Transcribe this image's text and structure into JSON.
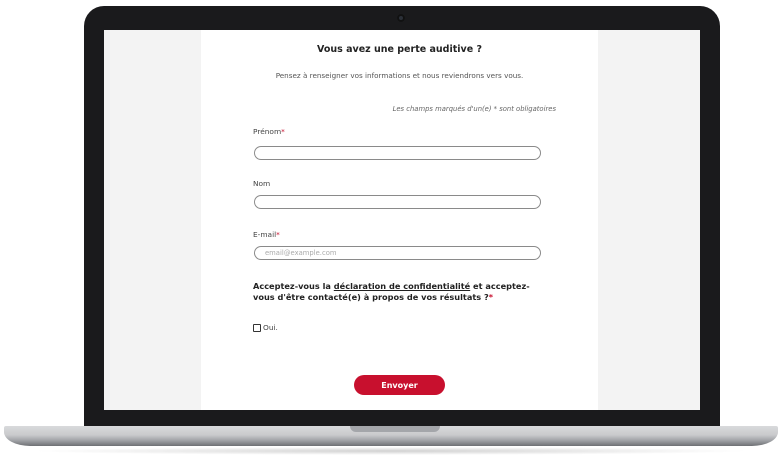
{
  "form": {
    "title": "Vous avez une perte auditive ?",
    "intro": "Pensez à renseigner vos informations et nous reviendrons vers vous.",
    "required_note": "Les champs marqués d'un(e) * sont obligatoires",
    "fields": [
      {
        "label": "Prénom",
        "required_mark": "*",
        "value": "",
        "placeholder": ""
      },
      {
        "label": "Nom",
        "required_mark": "",
        "value": "",
        "placeholder": ""
      },
      {
        "label": "E-mail",
        "required_mark": "*",
        "value": "",
        "placeholder": "email@example.com"
      }
    ],
    "consent": {
      "prefix": "Acceptez-vous la ",
      "link_text": "déclaration de confidentialité",
      "suffix": " et acceptez-vous d'être contacté(e) à propos de vos résultats ?",
      "required_mark": "*"
    },
    "checkbox": {
      "label": "Oui.",
      "checked": false
    },
    "submit_label": "Envoyer"
  },
  "colors": {
    "accent": "#c8102e",
    "bezel": "#1a1a1c",
    "screen_background": "#f3f3f3",
    "panel_background": "#ffffff"
  }
}
